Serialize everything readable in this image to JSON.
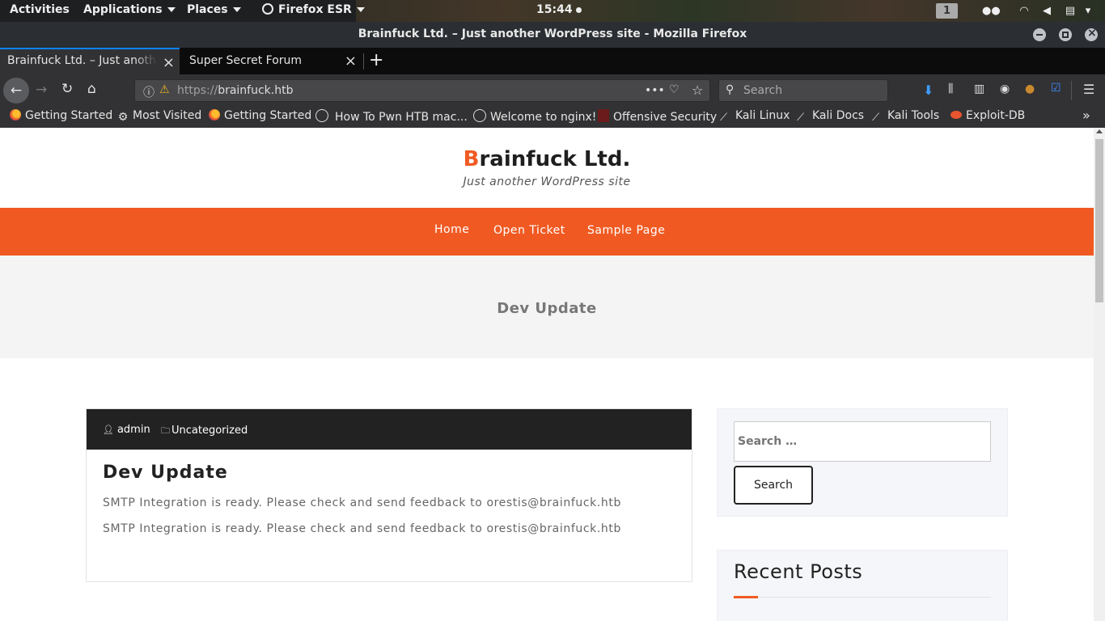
{
  "topbar": {
    "activities": "Activities",
    "applications": "Applications",
    "places": "Places",
    "app_menu": "Firefox ESR",
    "clock": "15:44",
    "workspace": "1"
  },
  "window": {
    "title": "Brainfuck Ltd. – Just another WordPress site - Mozilla Firefox"
  },
  "tabs": [
    {
      "label": "Brainfuck Ltd. – Just another WordPress site",
      "active": true
    },
    {
      "label": "Super Secret Forum",
      "active": false
    }
  ],
  "urlbar": {
    "scheme": "https://",
    "host": "brainfuck.htb",
    "more": "•••"
  },
  "searchbar": {
    "placeholder": "Search"
  },
  "bookmarks": [
    {
      "label": "Getting Started",
      "icon": "firefox-icon"
    },
    {
      "label": "Most Visited",
      "icon": "gear-icon"
    },
    {
      "label": "Getting Started",
      "icon": "firefox-icon"
    },
    {
      "label": "How To Pwn HTB mac...",
      "icon": "globe-icon"
    },
    {
      "label": "Welcome to nginx!",
      "icon": "globe-icon"
    },
    {
      "label": "Offensive Security",
      "icon": "offsec-icon"
    },
    {
      "label": "Kali Linux",
      "icon": "kali-icon"
    },
    {
      "label": "Kali Docs",
      "icon": "kali-icon"
    },
    {
      "label": "Kali Tools",
      "icon": "kali-icon"
    },
    {
      "label": "Exploit-DB",
      "icon": "exploitdb-icon"
    }
  ],
  "site": {
    "title_first": "B",
    "title_rest": "rainfuck Ltd.",
    "tagline": "Just another WordPress site",
    "accent_color": "#f05a22",
    "nav": [
      "Home",
      "Open Ticket",
      "Sample Page"
    ]
  },
  "hero": {
    "title": "Dev Update"
  },
  "post": {
    "author": "admin",
    "category": "Uncategorized",
    "title": "Dev Update",
    "paragraphs": [
      "SMTP Integration is ready. Please check and send feedback to orestis@brainfuck.htb",
      "SMTP Integration is ready. Please check and send feedback to orestis@brainfuck.htb"
    ]
  },
  "sidebar": {
    "search_placeholder": "Search …",
    "search_button": "Search",
    "recent_posts_title": "Recent Posts"
  }
}
